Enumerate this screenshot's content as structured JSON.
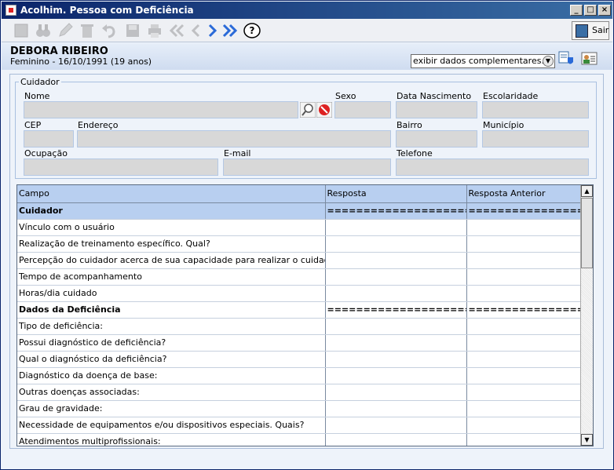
{
  "window": {
    "title": "Acolhim. Pessoa com Deficiência"
  },
  "toolbar": {
    "sair_label": "Sair",
    "icons": [
      "new-icon",
      "search-binoculars-icon",
      "edit-icon",
      "delete-icon",
      "undo-icon",
      "save-icon",
      "print-icon",
      "first-icon",
      "previous-icon",
      "next-icon",
      "last-icon",
      "help-icon"
    ]
  },
  "patient": {
    "name": "DEBORA RIBEIRO",
    "info": "Feminino - 16/10/1991 (19 anos)",
    "dropdown_value": "exibir dados complementares..."
  },
  "cuidador": {
    "legend": "Cuidador",
    "labels": {
      "nome": "Nome",
      "sexo": "Sexo",
      "nascimento": "Data Nascimento",
      "escolaridade": "Escolaridade",
      "cep": "CEP",
      "endereco": "Endereço",
      "bairro": "Bairro",
      "municipio": "Município",
      "ocupacao": "Ocupação",
      "email": "E-mail",
      "telefone": "Telefone"
    }
  },
  "grid": {
    "headers": {
      "campo": "Campo",
      "resposta": "Resposta",
      "anterior": "Resposta Anterior"
    },
    "rows": [
      {
        "campo": "Cuidador",
        "resposta": "===========================",
        "anterior": "=======================",
        "section": true
      },
      {
        "campo": "Vínculo com o usuário",
        "resposta": "",
        "anterior": ""
      },
      {
        "campo": "Realização de treinamento específico. Qual?",
        "resposta": "",
        "anterior": ""
      },
      {
        "campo": "Percepção do cuidador acerca de sua capacidade para realizar o cuidado",
        "resposta": "",
        "anterior": ""
      },
      {
        "campo": "Tempo de acompanhamento",
        "resposta": "",
        "anterior": ""
      },
      {
        "campo": "Horas/dia cuidado",
        "resposta": "",
        "anterior": ""
      },
      {
        "campo": "Dados da Deficiência",
        "resposta": "===========================",
        "anterior": "=======================",
        "section": true
      },
      {
        "campo": "Tipo de deficiência:",
        "resposta": "",
        "anterior": ""
      },
      {
        "campo": "Possui diagnóstico de deficiência?",
        "resposta": "",
        "anterior": ""
      },
      {
        "campo": "Qual o diagnóstico da deficiência?",
        "resposta": "",
        "anterior": ""
      },
      {
        "campo": "Diagnóstico da doença de base:",
        "resposta": "",
        "anterior": ""
      },
      {
        "campo": "Outras doenças associadas:",
        "resposta": "",
        "anterior": ""
      },
      {
        "campo": "Grau de gravidade:",
        "resposta": "",
        "anterior": ""
      },
      {
        "campo": "Necessidade de equipamentos e/ou dispositivos especiais. Quais?",
        "resposta": "",
        "anterior": ""
      },
      {
        "campo": "Atendimentos multiprofissionais:",
        "resposta": "",
        "anterior": ""
      }
    ]
  }
}
